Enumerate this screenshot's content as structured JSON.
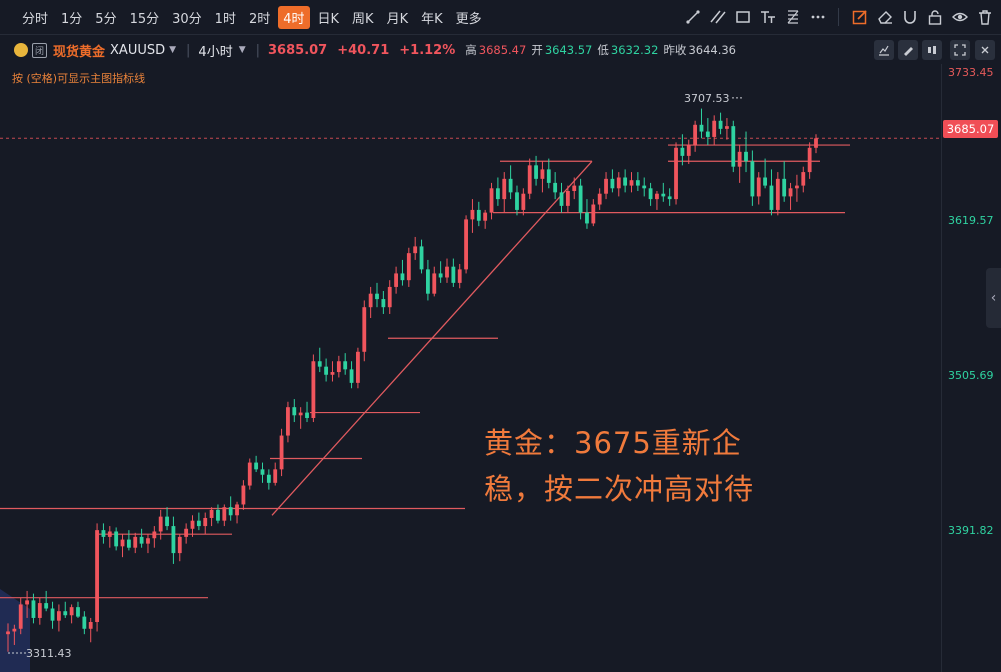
{
  "timeframes": [
    "分时",
    "1分",
    "5分",
    "15分",
    "30分",
    "1时",
    "2时",
    "4时",
    "日K",
    "周K",
    "月K",
    "年K",
    "更多"
  ],
  "active_timeframe": "4时",
  "symbol": {
    "name": "现货黄金",
    "code": "XAUUSD",
    "interval": "4小时",
    "price": "3685.07",
    "change": "+40.71",
    "change_pct": "+1.12%",
    "high_label": "高",
    "high": "3685.47",
    "open_label": "开",
    "open": "3643.57",
    "low_label": "低",
    "low": "3632.32",
    "prev_label": "昨收",
    "prev": "3644.36",
    "badge": "闭"
  },
  "hint": "按 (空格)可显示主图指标线",
  "price_axis": {
    "labels": [
      "3733.45",
      "3619.57",
      "3505.69",
      "3391.82"
    ],
    "current": "3685.07"
  },
  "chart_annotations": {
    "high_mark": "3707.53",
    "low_mark": "3311.43"
  },
  "annotation_text": [
    "黄金：3675重新企",
    "稳，按二次冲高对待"
  ],
  "colors": {
    "up": "#f0555d",
    "down": "#2fd3a1",
    "accent": "#ee6d2a",
    "bg": "#161a25",
    "line": "#e05a5f"
  },
  "icons": [
    "trend-line-icon",
    "parallel-lines-icon",
    "rectangle-icon",
    "text-tool-icon",
    "fib-icon",
    "more-dots-icon",
    "draw-edit-icon",
    "eraser-icon",
    "magnet-icon",
    "lock-icon",
    "eye-icon",
    "trash-icon"
  ],
  "chart_data": {
    "type": "candlestick",
    "title": "",
    "ylim": [
      3290,
      3740
    ],
    "candles": [
      [
        3318,
        3326,
        3305,
        3320
      ],
      [
        3320,
        3325,
        3310,
        3322
      ],
      [
        3322,
        3345,
        3318,
        3340
      ],
      [
        3340,
        3350,
        3330,
        3343
      ],
      [
        3343,
        3348,
        3326,
        3330
      ],
      [
        3330,
        3345,
        3325,
        3341
      ],
      [
        3341,
        3350,
        3335,
        3337
      ],
      [
        3337,
        3342,
        3322,
        3328
      ],
      [
        3328,
        3340,
        3320,
        3335
      ],
      [
        3335,
        3342,
        3330,
        3332
      ],
      [
        3332,
        3340,
        3326,
        3338
      ],
      [
        3338,
        3342,
        3330,
        3331
      ],
      [
        3331,
        3335,
        3318,
        3322
      ],
      [
        3322,
        3330,
        3312,
        3327
      ],
      [
        3327,
        3400,
        3320,
        3395
      ],
      [
        3395,
        3400,
        3385,
        3390
      ],
      [
        3390,
        3398,
        3382,
        3394
      ],
      [
        3394,
        3397,
        3380,
        3383
      ],
      [
        3383,
        3392,
        3375,
        3388
      ],
      [
        3388,
        3395,
        3380,
        3382
      ],
      [
        3382,
        3393,
        3378,
        3390
      ],
      [
        3390,
        3396,
        3382,
        3385
      ],
      [
        3385,
        3392,
        3378,
        3389
      ],
      [
        3389,
        3398,
        3382,
        3394
      ],
      [
        3394,
        3410,
        3388,
        3405
      ],
      [
        3405,
        3412,
        3395,
        3398
      ],
      [
        3398,
        3405,
        3370,
        3378
      ],
      [
        3378,
        3392,
        3372,
        3390
      ],
      [
        3390,
        3400,
        3385,
        3396
      ],
      [
        3396,
        3406,
        3390,
        3402
      ],
      [
        3402,
        3408,
        3395,
        3398
      ],
      [
        3398,
        3408,
        3392,
        3404
      ],
      [
        3404,
        3412,
        3398,
        3410
      ],
      [
        3410,
        3414,
        3400,
        3402
      ],
      [
        3402,
        3414,
        3398,
        3412
      ],
      [
        3412,
        3420,
        3402,
        3406
      ],
      [
        3406,
        3416,
        3400,
        3414
      ],
      [
        3414,
        3432,
        3410,
        3428
      ],
      [
        3428,
        3448,
        3425,
        3445
      ],
      [
        3445,
        3450,
        3438,
        3440
      ],
      [
        3440,
        3445,
        3430,
        3436
      ],
      [
        3436,
        3440,
        3425,
        3430
      ],
      [
        3430,
        3445,
        3428,
        3440
      ],
      [
        3440,
        3470,
        3435,
        3465
      ],
      [
        3465,
        3490,
        3460,
        3486
      ],
      [
        3486,
        3492,
        3475,
        3480
      ],
      [
        3480,
        3486,
        3470,
        3482
      ],
      [
        3482,
        3490,
        3475,
        3478
      ],
      [
        3478,
        3525,
        3475,
        3520
      ],
      [
        3520,
        3530,
        3512,
        3516
      ],
      [
        3516,
        3522,
        3505,
        3510
      ],
      [
        3510,
        3520,
        3505,
        3512
      ],
      [
        3512,
        3524,
        3508,
        3520
      ],
      [
        3520,
        3526,
        3510,
        3514
      ],
      [
        3514,
        3520,
        3500,
        3504
      ],
      [
        3504,
        3530,
        3500,
        3527
      ],
      [
        3527,
        3565,
        3520,
        3560
      ],
      [
        3560,
        3575,
        3552,
        3570
      ],
      [
        3570,
        3578,
        3560,
        3566
      ],
      [
        3566,
        3572,
        3555,
        3560
      ],
      [
        3560,
        3580,
        3555,
        3575
      ],
      [
        3575,
        3590,
        3570,
        3585
      ],
      [
        3585,
        3595,
        3576,
        3580
      ],
      [
        3580,
        3604,
        3575,
        3600
      ],
      [
        3600,
        3612,
        3595,
        3605
      ],
      [
        3605,
        3610,
        3585,
        3588
      ],
      [
        3588,
        3595,
        3565,
        3570
      ],
      [
        3570,
        3590,
        3568,
        3585
      ],
      [
        3585,
        3594,
        3578,
        3582
      ],
      [
        3582,
        3596,
        3578,
        3590
      ],
      [
        3590,
        3596,
        3575,
        3578
      ],
      [
        3578,
        3592,
        3574,
        3588
      ],
      [
        3588,
        3628,
        3585,
        3625
      ],
      [
        3625,
        3640,
        3615,
        3632
      ],
      [
        3632,
        3638,
        3620,
        3624
      ],
      [
        3624,
        3632,
        3618,
        3630
      ],
      [
        3630,
        3652,
        3625,
        3648
      ],
      [
        3648,
        3656,
        3635,
        3640
      ],
      [
        3640,
        3660,
        3630,
        3655
      ],
      [
        3655,
        3665,
        3640,
        3645
      ],
      [
        3645,
        3650,
        3628,
        3632
      ],
      [
        3632,
        3648,
        3628,
        3644
      ],
      [
        3644,
        3670,
        3640,
        3665
      ],
      [
        3665,
        3672,
        3650,
        3655
      ],
      [
        3655,
        3668,
        3645,
        3662
      ],
      [
        3662,
        3670,
        3648,
        3652
      ],
      [
        3652,
        3660,
        3640,
        3645
      ],
      [
        3645,
        3652,
        3630,
        3635
      ],
      [
        3635,
        3650,
        3630,
        3646
      ],
      [
        3646,
        3656,
        3640,
        3650
      ],
      [
        3650,
        3655,
        3625,
        3630
      ],
      [
        3630,
        3640,
        3618,
        3622
      ],
      [
        3622,
        3640,
        3620,
        3636
      ],
      [
        3636,
        3648,
        3632,
        3644
      ],
      [
        3644,
        3660,
        3640,
        3655
      ],
      [
        3655,
        3662,
        3645,
        3648
      ],
      [
        3648,
        3660,
        3642,
        3656
      ],
      [
        3656,
        3662,
        3645,
        3650
      ],
      [
        3650,
        3660,
        3645,
        3654
      ],
      [
        3654,
        3660,
        3646,
        3650
      ],
      [
        3650,
        3656,
        3642,
        3648
      ],
      [
        3648,
        3652,
        3635,
        3640
      ],
      [
        3640,
        3646,
        3632,
        3644
      ],
      [
        3644,
        3652,
        3638,
        3642
      ],
      [
        3642,
        3648,
        3635,
        3640
      ],
      [
        3640,
        3682,
        3636,
        3678
      ],
      [
        3678,
        3688,
        3665,
        3672
      ],
      [
        3672,
        3684,
        3666,
        3680
      ],
      [
        3680,
        3698,
        3675,
        3695
      ],
      [
        3695,
        3707,
        3685,
        3690
      ],
      [
        3690,
        3700,
        3680,
        3686
      ],
      [
        3686,
        3702,
        3680,
        3698
      ],
      [
        3698,
        3704,
        3688,
        3692
      ],
      [
        3692,
        3700,
        3684,
        3694
      ],
      [
        3694,
        3698,
        3660,
        3664
      ],
      [
        3664,
        3680,
        3652,
        3675
      ],
      [
        3675,
        3690,
        3660,
        3668
      ],
      [
        3668,
        3676,
        3635,
        3642
      ],
      [
        3642,
        3660,
        3636,
        3656
      ],
      [
        3656,
        3670,
        3648,
        3650
      ],
      [
        3650,
        3662,
        3628,
        3632
      ],
      [
        3632,
        3660,
        3628,
        3655
      ],
      [
        3655,
        3668,
        3638,
        3642
      ],
      [
        3642,
        3652,
        3632,
        3648
      ],
      [
        3648,
        3658,
        3638,
        3650
      ],
      [
        3650,
        3664,
        3645,
        3660
      ],
      [
        3660,
        3682,
        3655,
        3678
      ],
      [
        3678,
        3688,
        3674,
        3685
      ]
    ]
  }
}
